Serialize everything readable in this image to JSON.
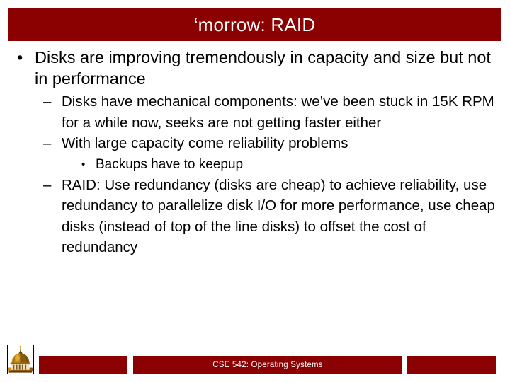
{
  "slide": {
    "title": "‘morrow: RAID",
    "accent_color": "#8B0000",
    "background_color": "#FFFFFF",
    "text_color": "#000000"
  },
  "bullets": {
    "level1_marker": "•",
    "level2_marker": "–",
    "level3_marker": "•",
    "items": [
      {
        "text": "Disks are improving tremendously in capacity and size but not in performance",
        "children": [
          {
            "text": "Disks have mechanical components: we’ve been stuck in 15K RPM for a while now, seeks are not getting faster either",
            "children": []
          },
          {
            "text": "With large capacity come reliability problems",
            "children": [
              {
                "text": "Backups have to keepup"
              }
            ]
          },
          {
            "text": "RAID: Use redundancy (disks are cheap) to achieve reliability, use redundancy to parallelize disk I/O for more performance, use cheap disks (instead of top of the line disks) to offset the cost of redundancy",
            "children": []
          }
        ]
      }
    ]
  },
  "footer": {
    "logo_alt": "golden-dome-logo",
    "center_text": "CSE 542: Operating Systems",
    "left_bar_text": "",
    "right_bar_text": ""
  }
}
